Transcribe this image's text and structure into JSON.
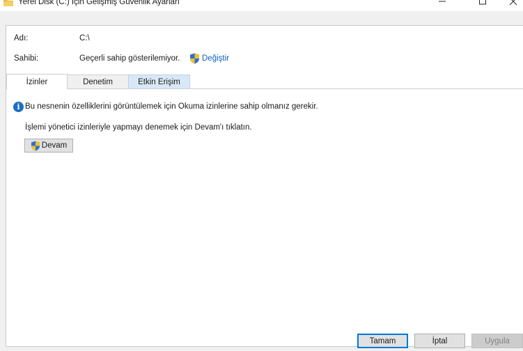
{
  "window": {
    "title": "Yerel Disk (C:) İçin Gelişmiş Güvenlik Ayarları",
    "icons": [
      "folder-icon",
      "minimize-icon",
      "maximize-icon",
      "close-icon"
    ]
  },
  "details": {
    "name_label": "Adı:",
    "name_value": "C:\\",
    "owner_label": "Sahibi:",
    "owner_value": "Geçerli sahip gösterilemiyor.",
    "change_link": "Değiştir"
  },
  "tabs": [
    {
      "label": "İzinler",
      "selected": true
    },
    {
      "label": "Denetim",
      "selected": false
    },
    {
      "label": "Etkin Erişim",
      "selected": false
    }
  ],
  "main": {
    "info_message": "Bu nesnenin özelliklerini görüntülemek için Okuma izinlerine sahip olmanız gerekir.",
    "admin_message": "İşlemi yönetici izinleriyle yapmayı denemek için Devam'ı tıklatın.",
    "continue_button": "Devam"
  },
  "footer": {
    "ok_button": "Tamam",
    "cancel_button": "İptal",
    "apply_button": "Uygula",
    "apply_enabled": false
  },
  "colors": {
    "link": "#0a5fc2",
    "info_icon": "#1b6ec2",
    "default_button_border": "#0078d7",
    "shield_blue": "#2f6fd0",
    "shield_yellow": "#f2c12e"
  }
}
